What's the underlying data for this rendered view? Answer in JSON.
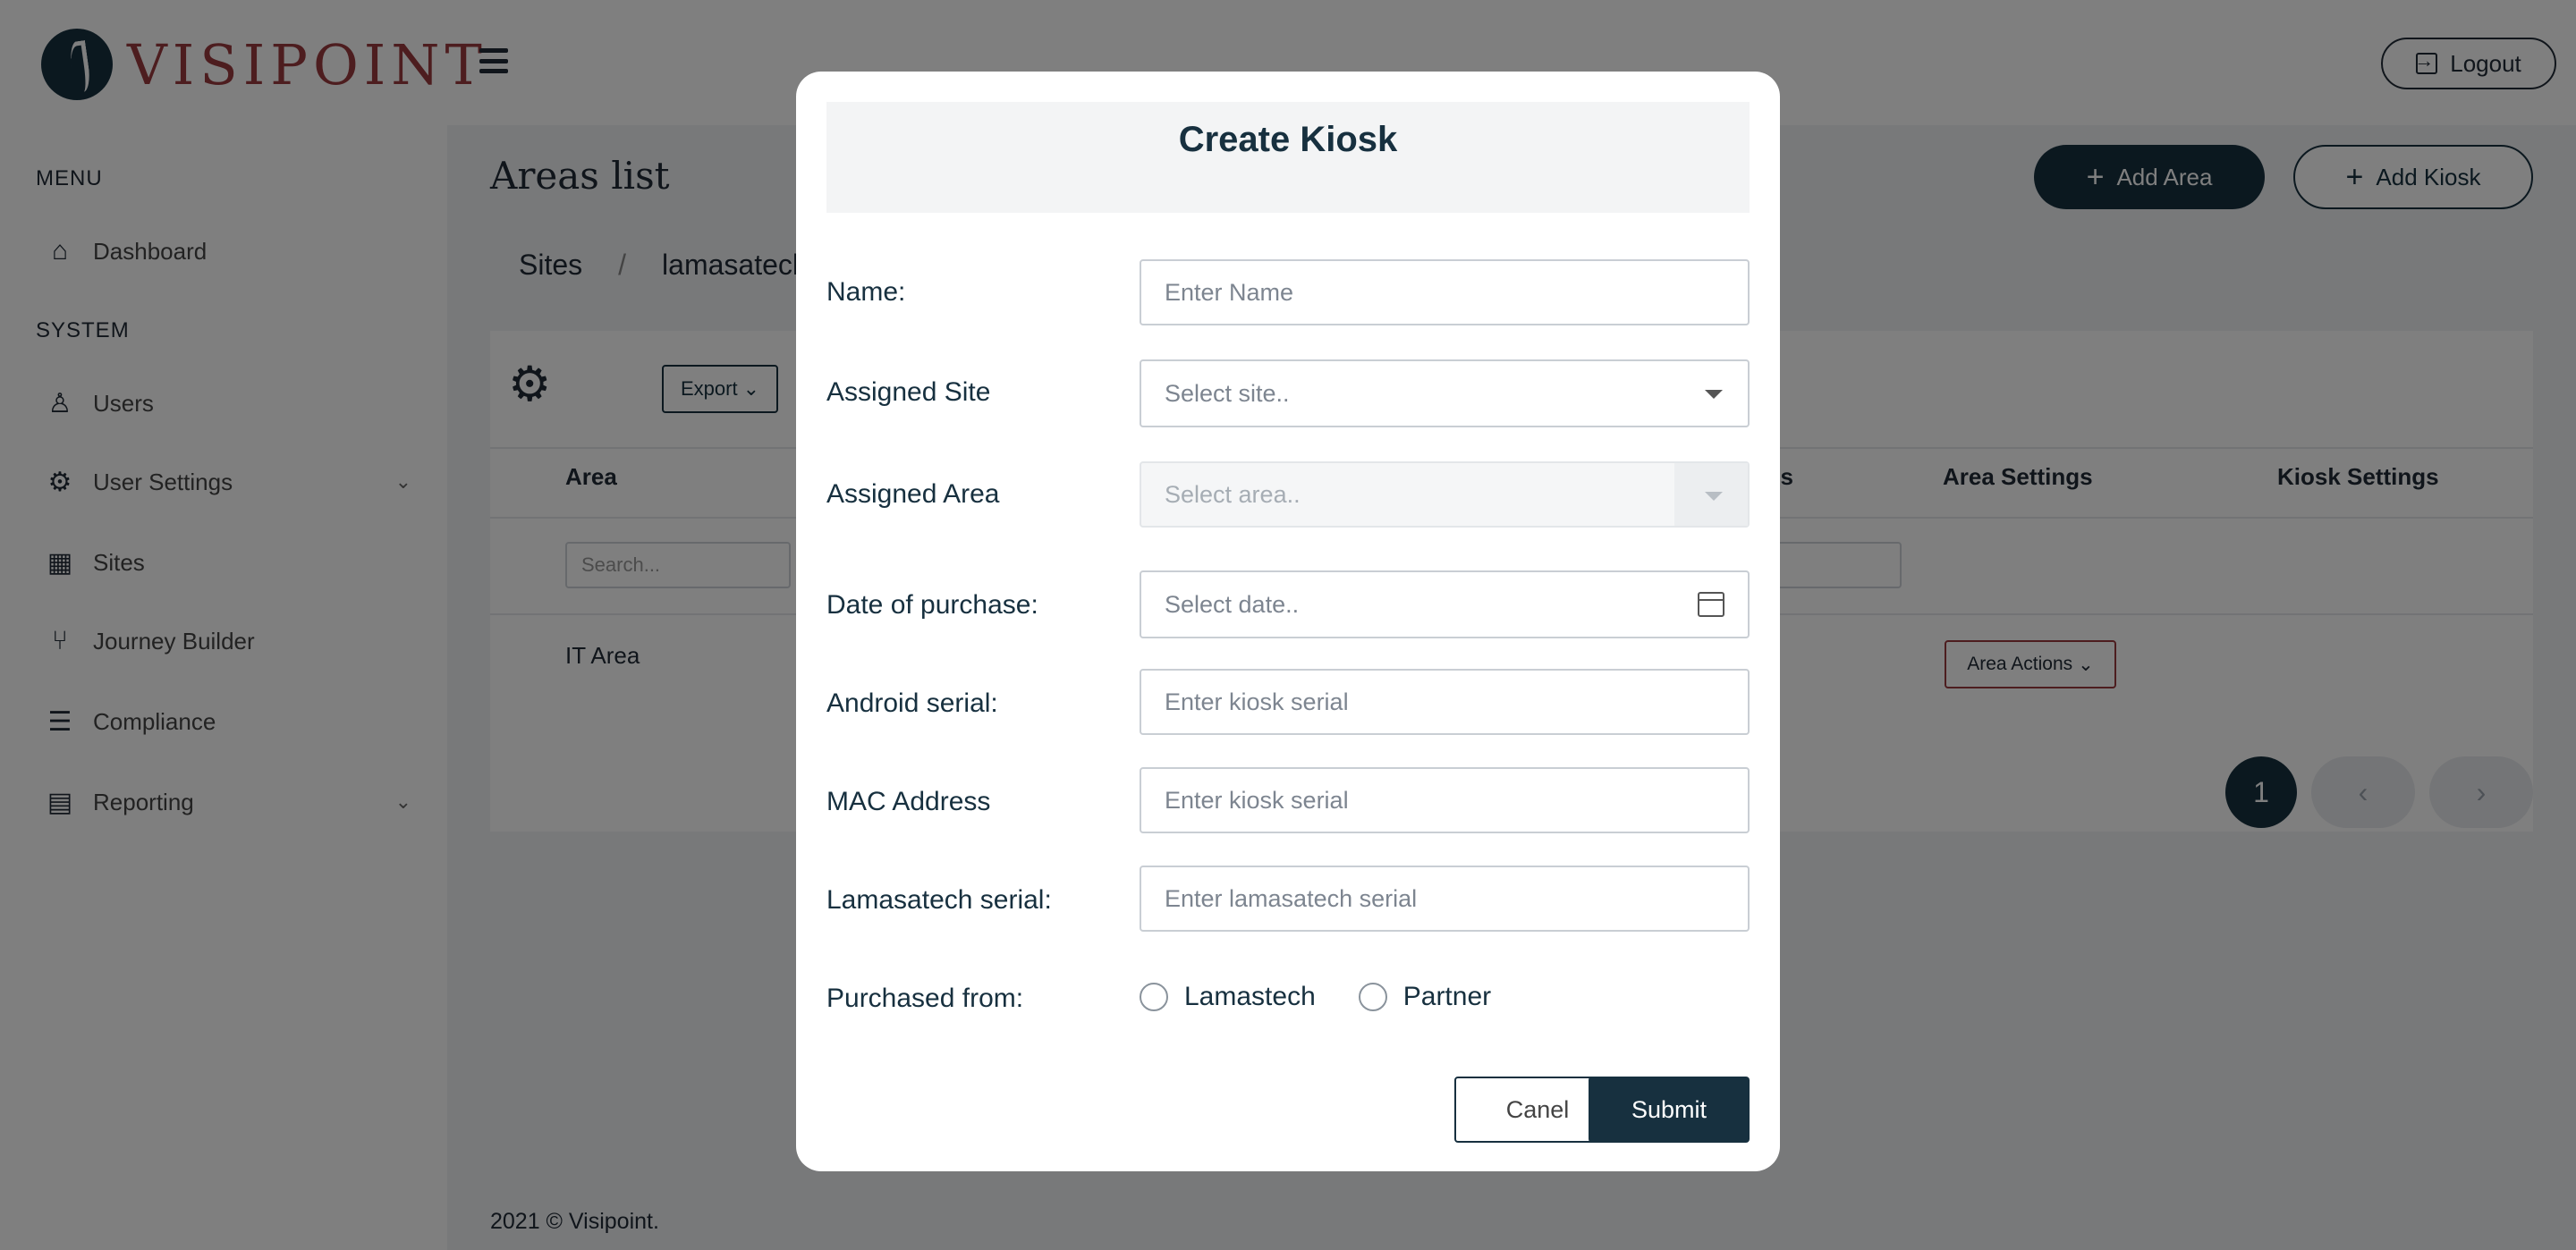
{
  "header": {
    "logo_text": "VISIPOINT",
    "logout_label": "Logout"
  },
  "sidebar": {
    "menu_heading": "MENU",
    "system_heading": "SYSTEM",
    "items": [
      {
        "label": "Dashboard",
        "icon": "home-icon"
      },
      {
        "label": "Users",
        "icon": "user-icon"
      },
      {
        "label": "User Settings",
        "icon": "gear-icon"
      },
      {
        "label": "Sites",
        "icon": "building-icon"
      },
      {
        "label": "Journey Builder",
        "icon": "branch-icon"
      },
      {
        "label": "Compliance",
        "icon": "checklist-icon"
      },
      {
        "label": "Reporting",
        "icon": "report-icon"
      }
    ]
  },
  "main": {
    "title": "Areas list",
    "add_area_label": "Add Area",
    "add_kiosk_label": "Add Kiosk",
    "breadcrumb": [
      "Sites",
      "/",
      "lamasatech"
    ],
    "export_label": "Export",
    "columns": [
      "Area",
      "ss",
      "Area Settings",
      "Kiosk Settings"
    ],
    "search_placeholder": "Search...",
    "rows": [
      {
        "area": "IT Area",
        "actions_label": "Area Actions"
      }
    ],
    "pagination": {
      "current": "1",
      "prev": "‹",
      "next": "›"
    }
  },
  "footer": {
    "text": "2021 © Visipoint."
  },
  "modal": {
    "title": "Create Kiosk",
    "fields": {
      "name": {
        "label": "Name:",
        "placeholder": "Enter  Name"
      },
      "assigned_site": {
        "label": "Assigned Site",
        "placeholder": "Select site.."
      },
      "assigned_area": {
        "label": "Assigned Area",
        "placeholder": "Select area.."
      },
      "date_of_purchase": {
        "label": "Date of purchase:",
        "placeholder": "Select date.."
      },
      "android_serial": {
        "label": "Android serial:",
        "placeholder": "Enter kiosk serial"
      },
      "mac_address": {
        "label": "MAC Address",
        "placeholder": "Enter kiosk serial"
      },
      "lamasatech_serial": {
        "label": "Lamasatech serial:",
        "placeholder": "Enter lamasatech serial"
      }
    },
    "purchased_from": {
      "label": "Purchased from:",
      "options": [
        "Lamastech",
        "Partner"
      ]
    },
    "cancel_label": "Canel",
    "submit_label": "Submit"
  },
  "colors": {
    "brand_dark": "#17303f",
    "brand_red": "#9a3a3f",
    "overlay": "rgba(0,0,0,0.5)"
  }
}
